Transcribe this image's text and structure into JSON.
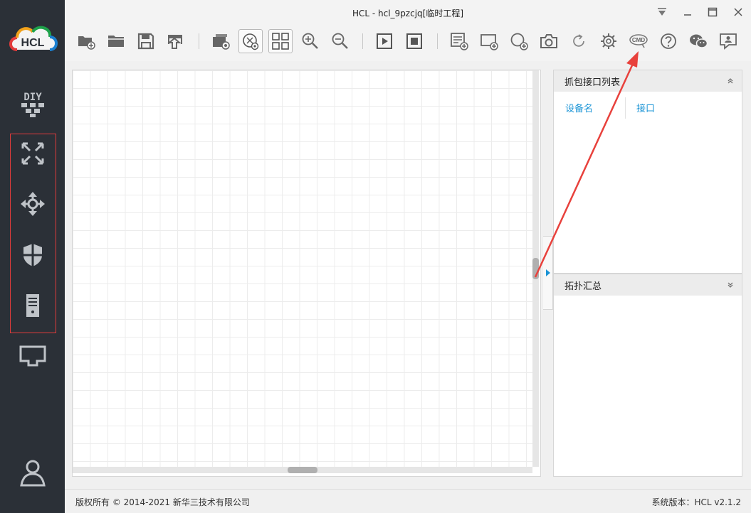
{
  "window": {
    "title": "HCL - hcl_9pzcjq[临时工程]"
  },
  "brand": {
    "logo_text": "HCL",
    "accent": "#e23b3b"
  },
  "sidebar": {
    "items": [
      {
        "icon": "diy-icon",
        "label": "DIY"
      },
      {
        "icon": "router-icon"
      },
      {
        "icon": "switch-icon"
      },
      {
        "icon": "firewall-icon"
      },
      {
        "icon": "server-icon"
      },
      {
        "icon": "terminal-icon"
      },
      {
        "icon": "user-icon"
      }
    ]
  },
  "toolbar": {
    "icons": [
      "new-project-icon",
      "open-project-icon",
      "save-icon",
      "export-icon",
      "screenshot-view-icon",
      "topology-view-icon",
      "grid-layout-icon",
      "zoom-in-icon",
      "zoom-out-icon",
      "start-icon",
      "stop-icon",
      "add-note-icon",
      "add-rect-icon",
      "add-ellipse-icon",
      "camera-icon",
      "refresh-icon",
      "settings-icon",
      "cmd-icon",
      "help-icon",
      "wechat-icon",
      "feedback-icon"
    ],
    "cmd_label": "CMD"
  },
  "capture_panel": {
    "title": "抓包接口列表",
    "col_device": "设备名",
    "col_interface": "接口"
  },
  "topology_panel": {
    "title": "拓扑汇总"
  },
  "footer": {
    "copyright": "版权所有 © 2014-2021 新华三技术有限公司",
    "version": "系统版本：HCL v2.1.2"
  }
}
